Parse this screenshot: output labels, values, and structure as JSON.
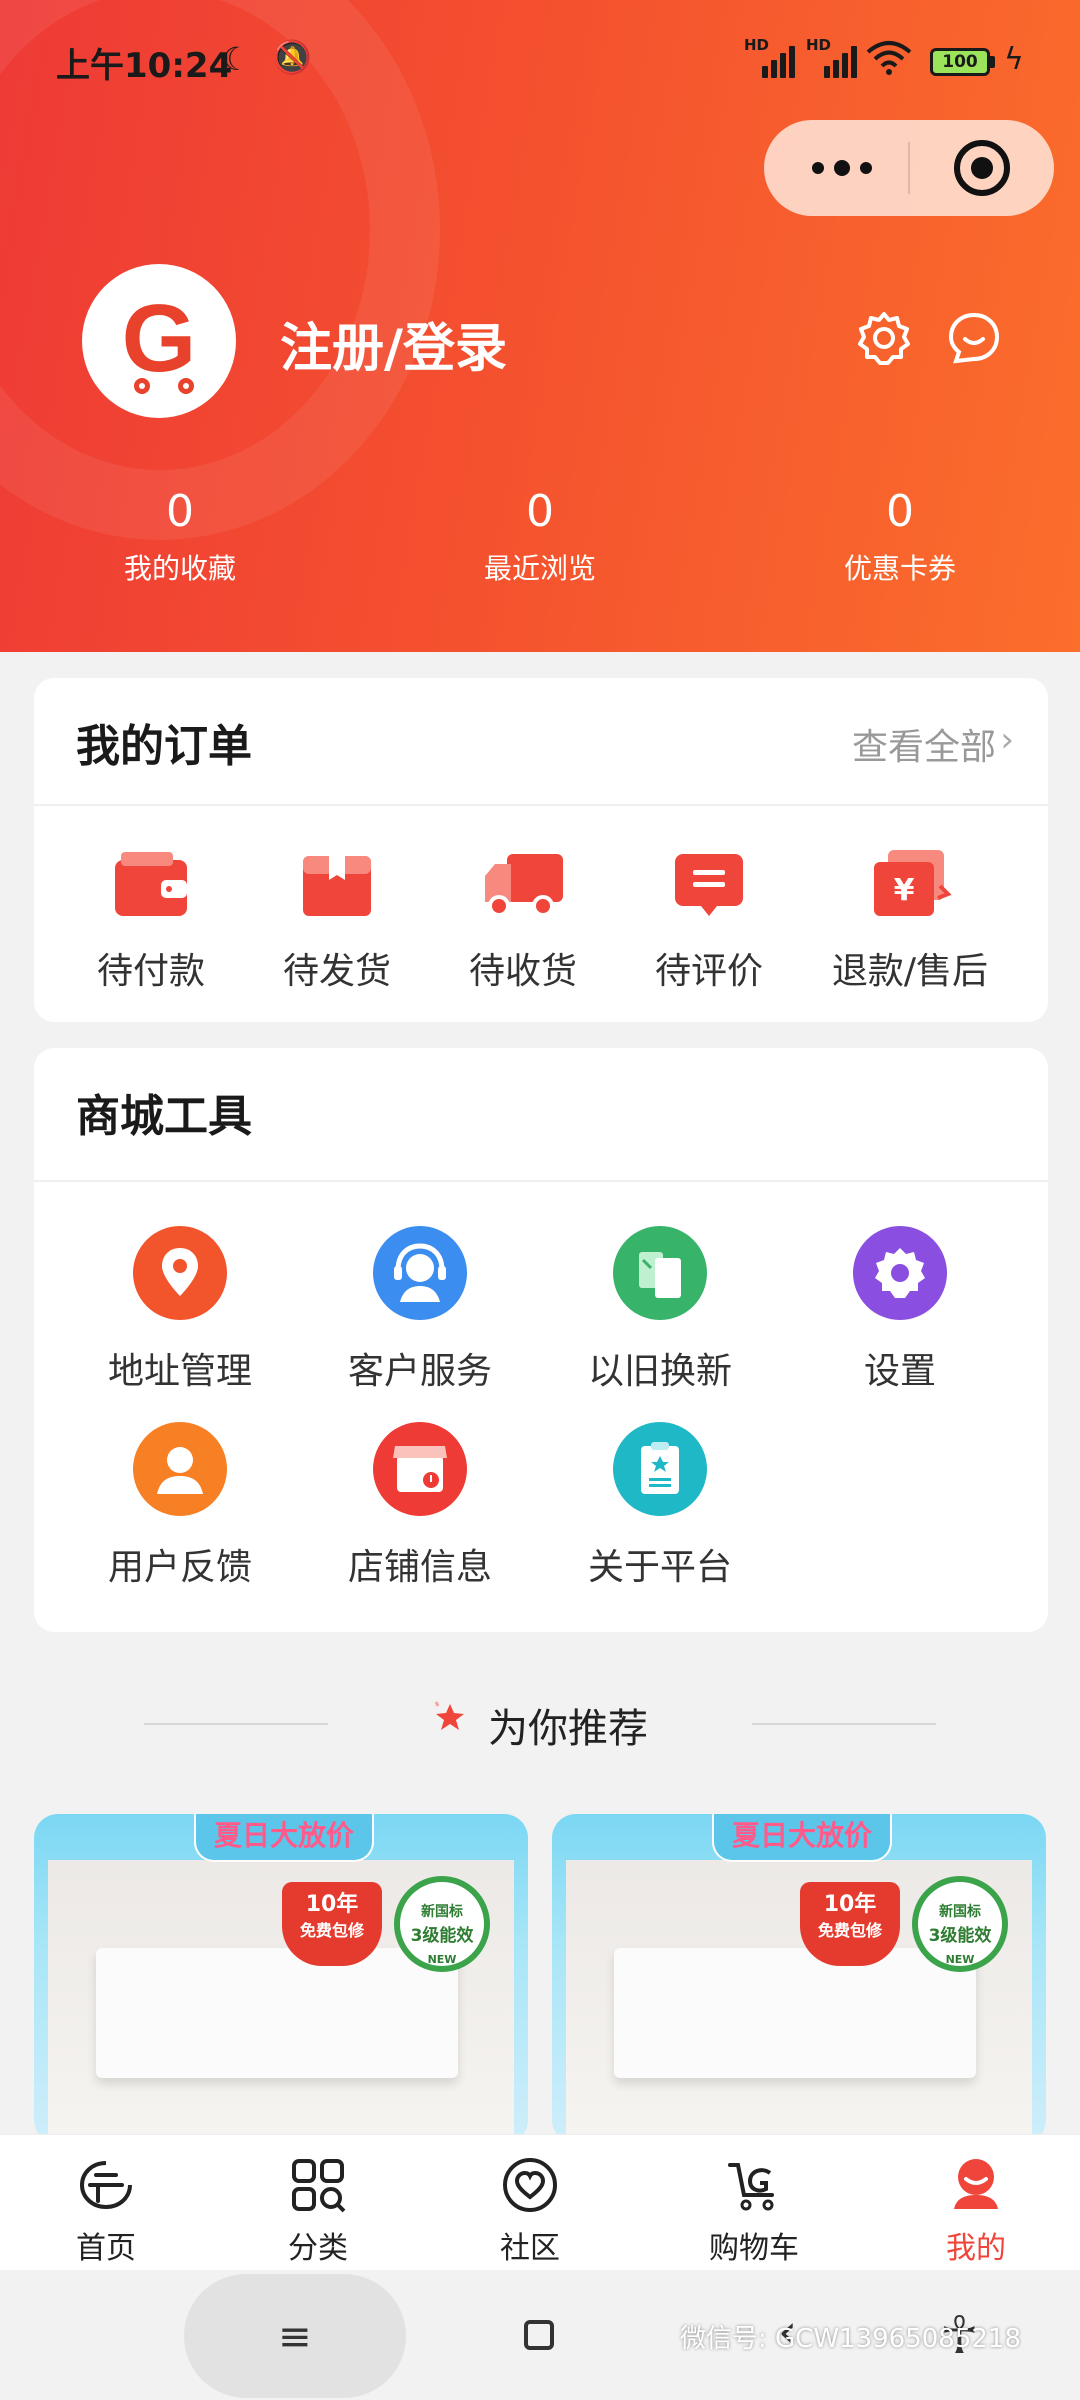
{
  "status_bar": {
    "time": "上午10:24",
    "battery": "100",
    "signal_1": "HD",
    "signal_2": "HD"
  },
  "profile": {
    "login_label": "注册/登录"
  },
  "stats": [
    {
      "value": "0",
      "label": "我的收藏"
    },
    {
      "value": "0",
      "label": "最近浏览"
    },
    {
      "value": "0",
      "label": "优惠卡券"
    }
  ],
  "orders": {
    "title": "我的订单",
    "view_all": "查看全部",
    "items": [
      {
        "label": "待付款",
        "icon": "wallet-icon"
      },
      {
        "label": "待发货",
        "icon": "package-icon"
      },
      {
        "label": "待收货",
        "icon": "truck-icon"
      },
      {
        "label": "待评价",
        "icon": "review-icon"
      },
      {
        "label": "退款/售后",
        "icon": "refund-icon"
      }
    ]
  },
  "tools": {
    "title": "商城工具",
    "items": [
      {
        "label": "地址管理",
        "icon": "location-icon",
        "color": "#f2552c"
      },
      {
        "label": "客户服务",
        "icon": "headset-icon",
        "color": "#3b8ef0"
      },
      {
        "label": "以旧换新",
        "icon": "exchange-icon",
        "color": "#37b36a"
      },
      {
        "label": "设置",
        "icon": "gear-icon",
        "color": "#8a4fe0"
      },
      {
        "label": "用户反馈",
        "icon": "user-icon",
        "color": "#f77f24"
      },
      {
        "label": "店铺信息",
        "icon": "shop-icon",
        "color": "#ef3b36"
      },
      {
        "label": "关于平台",
        "icon": "clipboard-icon",
        "color": "#1fb8c6"
      }
    ]
  },
  "recommend": {
    "title": "为你推荐",
    "products": [
      {
        "banner": "夏日大放价",
        "badge_a_line1": "10年",
        "badge_a_line2": "免费包修",
        "badge_b_line1": "新国标",
        "badge_b_line2": "3级能效",
        "badge_b_line3": "NEW"
      },
      {
        "banner": "夏日大放价",
        "badge_a_line1": "10年",
        "badge_a_line2": "免费包修",
        "badge_b_line1": "新国标",
        "badge_b_line2": "3级能效",
        "badge_b_line3": "NEW"
      }
    ]
  },
  "tabbar": [
    {
      "label": "首页",
      "icon": "home-icon"
    },
    {
      "label": "分类",
      "icon": "category-icon"
    },
    {
      "label": "社区",
      "icon": "heart-icon"
    },
    {
      "label": "购物车",
      "icon": "cart-icon"
    },
    {
      "label": "我的",
      "icon": "profile-icon",
      "active": true
    }
  ],
  "watermark": "微信号: GCW13965085218",
  "colors": {
    "accent": "#f0453a",
    "header_start": "#ee3a36",
    "header_end": "#fb6e2c"
  }
}
